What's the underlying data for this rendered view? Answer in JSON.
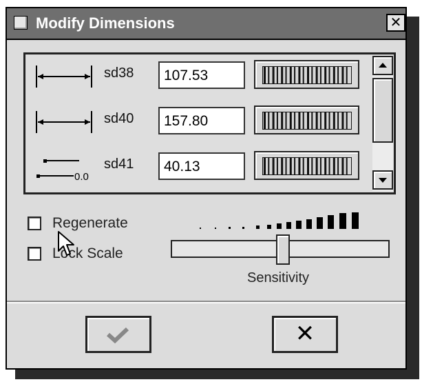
{
  "dialog": {
    "title": "Modify Dimensions",
    "close_glyph": "✕"
  },
  "dimensions": [
    {
      "name": "sd38",
      "value": "107.53",
      "icon": "linear-dimension-icon"
    },
    {
      "name": "sd40",
      "value": "157.80",
      "icon": "linear-dimension-icon"
    },
    {
      "name": "sd41",
      "value": "40.13",
      "icon": "angular-dimension-icon",
      "icon_text": "0.0"
    }
  ],
  "options": {
    "regenerate_label": "Regenerate",
    "regenerate_checked": false,
    "lock_scale_label": "Lock Scale",
    "lock_scale_checked": false
  },
  "sensitivity": {
    "label": "Sensitivity",
    "level": 0.45
  },
  "buttons": {
    "ok_icon": "checkmark-icon",
    "cancel_glyph": "✕"
  },
  "colors": {
    "titlebar": "#6f6f6f",
    "dialog_bg": "#dcdcdc"
  }
}
